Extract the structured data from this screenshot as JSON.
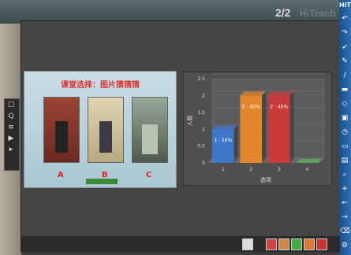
{
  "header": {
    "page_indicator": "2/2",
    "brand": "HiTeach"
  },
  "toolbar": {
    "brand": "HiT"
  },
  "left_strip": {
    "icons": [
      "☐",
      "Q",
      "≡",
      "▶",
      "▸"
    ]
  },
  "slide": {
    "title": "课堂选择：图片猜猜猜",
    "photos": [
      {
        "label": "A",
        "color": "#8a3a2a"
      },
      {
        "label": "B",
        "color": "#c9b98f"
      },
      {
        "label": "C",
        "color": "#5a6a5a"
      }
    ]
  },
  "chart_data": {
    "type": "bar",
    "categories": [
      "1",
      "2",
      "3",
      "4"
    ],
    "values": [
      1,
      2,
      2,
      0
    ],
    "bar_labels": [
      "1 · 20%",
      "2 · 40%",
      "2 · 40%",
      ""
    ],
    "colors": [
      "#3f78c8",
      "#e2872b",
      "#c83a3a",
      "#5aa05a"
    ],
    "xlabel": "选项",
    "ylabel": "人数",
    "ylim": [
      0,
      2.5
    ],
    "yticks": [
      "0",
      "0.5",
      "1",
      "1.5",
      "2",
      "2.5"
    ]
  },
  "bottombar": {
    "icons": [
      "camera-icon",
      "chart-icon",
      "grid-icon",
      "save-icon",
      "export-icon",
      "close-icon"
    ]
  }
}
